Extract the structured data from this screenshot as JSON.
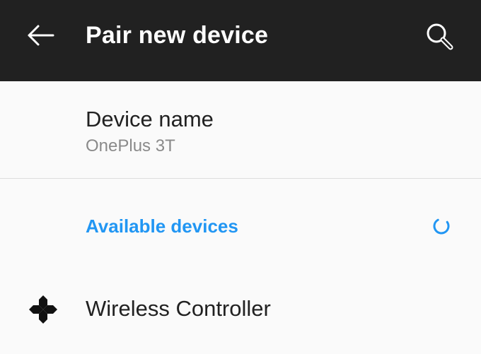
{
  "app_bar": {
    "title": "Pair new device",
    "back_icon": "arrow-left-icon",
    "search_icon": "search-icon",
    "background": "#212121",
    "foreground": "#ffffff"
  },
  "device_name": {
    "label": "Device name",
    "value": "OnePlus 3T"
  },
  "available_devices": {
    "header": "Available devices",
    "accent_color": "#2196f3",
    "status_icon": "loading-spinner-icon",
    "items": [
      {
        "name": "Wireless Controller",
        "icon": "gamepad-icon"
      }
    ]
  }
}
